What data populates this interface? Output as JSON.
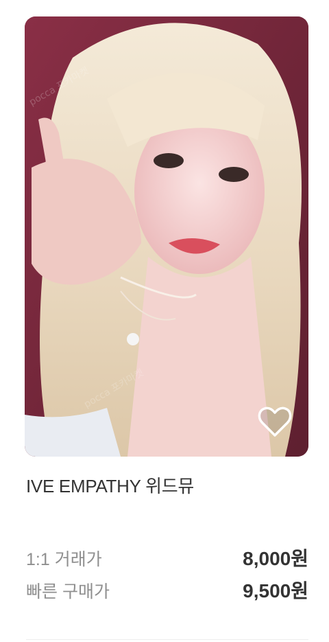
{
  "product": {
    "title": "IVE EMPATHY 위드뮤",
    "image_alt": "photocard photo",
    "watermark": "pocca 포카마켓",
    "favorite_icon": "heart-outline-icon"
  },
  "prices": [
    {
      "label": "1:1 거래가",
      "value": "8,000원"
    },
    {
      "label": "빠른 구매가",
      "value": "9,500원"
    }
  ],
  "colors": {
    "background_accent": "#7c2c3f",
    "text_primary": "#333333",
    "text_secondary": "#8f8f8f"
  }
}
